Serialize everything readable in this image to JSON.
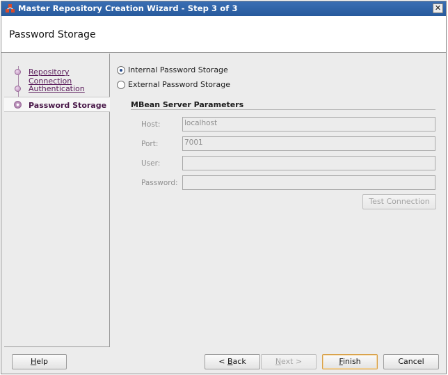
{
  "window": {
    "title": "Master Repository Creation Wizard - Step 3 of 3",
    "close_label": "✕"
  },
  "header": {
    "title": "Password Storage"
  },
  "nav": {
    "items": [
      {
        "label": "Repository Connection"
      },
      {
        "label": "Authentication"
      },
      {
        "label": "Password Storage"
      }
    ]
  },
  "storage_options": {
    "internal_label": "Internal Password Storage",
    "external_label": "External Password Storage",
    "selected": "internal"
  },
  "mbean": {
    "section_title": "MBean Server Parameters",
    "host_label": "Host:",
    "host_value": "localhost",
    "port_label": "Port:",
    "port_value": "7001",
    "user_label": "User:",
    "user_value": "",
    "password_label": "Password:",
    "password_value": "",
    "test_connection_label": "Test Connection"
  },
  "footer": {
    "help_mnemonic": "H",
    "help_rest": "elp",
    "back_prefix": "< ",
    "back_mnemonic": "B",
    "back_rest": "ack",
    "next_mnemonic": "N",
    "next_rest": "ext >",
    "finish_mnemonic": "F",
    "finish_rest": "inish",
    "cancel_label": "Cancel"
  }
}
